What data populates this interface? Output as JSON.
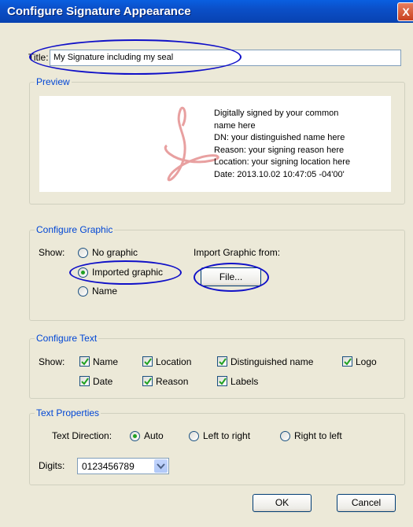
{
  "window": {
    "title": "Configure Signature Appearance",
    "close_glyph": "X"
  },
  "title_field": {
    "label": "Title:",
    "value": "My Signature including my seal"
  },
  "preview": {
    "label": "Preview",
    "lines": [
      "Digitally signed by your common",
      "name here",
      "DN: your distinguished name here",
      "Reason: your signing reason here",
      "Location: your signing location here",
      "Date: 2013.10.02 10:47:05 -04'00'"
    ]
  },
  "configure_graphic": {
    "label": "Configure Graphic",
    "show_label": "Show:",
    "options": [
      "No graphic",
      "Imported graphic",
      "Name"
    ],
    "selected": "Imported graphic",
    "import_label": "Import Graphic from:",
    "file_button": "File..."
  },
  "configure_text": {
    "label": "Configure Text",
    "show_label": "Show:",
    "checkboxes": [
      "Name",
      "Location",
      "Distinguished name",
      "Logo",
      "Date",
      "Reason",
      "Labels"
    ],
    "all_checked": true
  },
  "text_properties": {
    "label": "Text Properties",
    "direction_label": "Text Direction:",
    "direction_options": [
      "Auto",
      "Left to right",
      "Right to left"
    ],
    "direction_selected": "Auto",
    "digits_label": "Digits:",
    "digits_value": "0123456789"
  },
  "buttons": {
    "ok": "OK",
    "cancel": "Cancel"
  },
  "colors": {
    "titlebar": "#0A5FE0",
    "dialog_bg": "#ECE9D8",
    "group_label": "#0046D5",
    "annotation": "#1010C8",
    "watermark": "#E8A0A0"
  }
}
